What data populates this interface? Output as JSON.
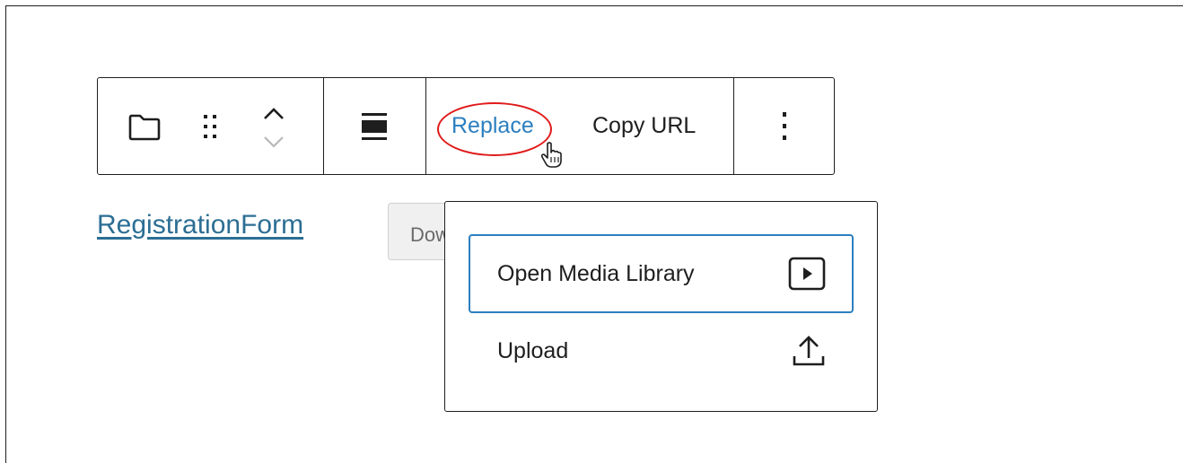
{
  "toolbar": {
    "block_icon": "folder-icon",
    "drag_icon": "drag-handle-icon",
    "move_up_icon": "chevron-up-icon",
    "move_down_icon": "chevron-down-icon",
    "align_icon": "align-wide-icon",
    "replace_label": "Replace",
    "copy_url_label": "Copy URL",
    "more_icon": "more-vertical-icon"
  },
  "file": {
    "link_text": "RegistrationForm",
    "download_label": "Download"
  },
  "replace_menu": {
    "items": [
      {
        "label": "Open Media Library",
        "icon": "media-library-icon",
        "focused": true
      },
      {
        "label": "Upload",
        "icon": "upload-icon",
        "focused": false
      }
    ]
  },
  "colors": {
    "accent": "#2c7fbf",
    "link": "#2c6e94",
    "highlight": "#e01b1b",
    "border": "#1e1e1e"
  }
}
